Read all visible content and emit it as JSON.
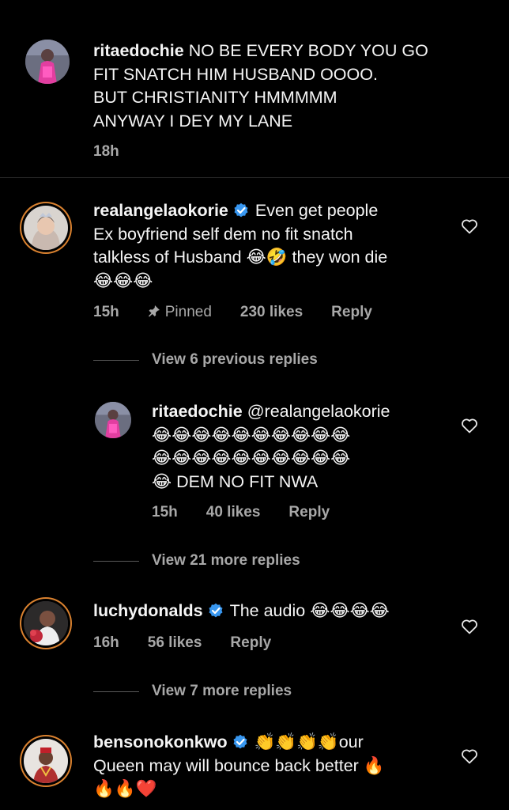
{
  "caption": {
    "username": "ritaedochie",
    "text_line1": "NO BE EVERY BODY YOU GO",
    "text_line2": "FIT SNATCH HIM HUSBAND OOOO.",
    "text_line3": "BUT CHRISTIANITY HMMMMM",
    "text_line4": "ANYWAY I DEY MY LANE",
    "time": "18h"
  },
  "comments": [
    {
      "username": "realangelaokorie",
      "line1": "Even get people",
      "line2": "Ex boyfriend self dem no fit snatch",
      "line3a": "talkless of Husband",
      "line3_emoji": "😂🤣",
      "line3b": "they won die",
      "line4_emoji": "😂😂😂",
      "time": "15h",
      "pinned": "Pinned",
      "likes": "230 likes",
      "reply": "Reply",
      "view_previous": "View 6 previous replies"
    },
    {
      "username": "ritaedochie",
      "mention": "@realangelaokorie",
      "emoji_row1": "😂😂😂😂😂😂😂😂😂😂",
      "emoji_row2": "😂😂😂😂😂😂😂😂😂😂",
      "line3_emoji": "😂",
      "line3": "DEM NO FIT NWA",
      "time": "15h",
      "likes": "40 likes",
      "reply": "Reply",
      "view_more": "View 21 more replies"
    },
    {
      "username": "luchydonalds",
      "text": "The audio",
      "emoji": "😂😂😂😂",
      "time": "16h",
      "likes": "56 likes",
      "reply": "Reply",
      "view_more": "View 7 more replies"
    },
    {
      "username": "bensonokonkwo",
      "line1_emoji": "👏👏👏👏",
      "line1": "our",
      "line2": "Queen may will bounce back better",
      "line2_emoji": "🔥",
      "line3_emoji": "🔥🔥❤️"
    }
  ],
  "colors": {
    "background": "#000000",
    "text": "#f5f5f5",
    "secondary": "#a8a8a8",
    "verified": "#3897f0",
    "story_ring": "#d9812f"
  },
  "icons": [
    "heart-icon",
    "verified-badge-icon",
    "pin-icon"
  ]
}
